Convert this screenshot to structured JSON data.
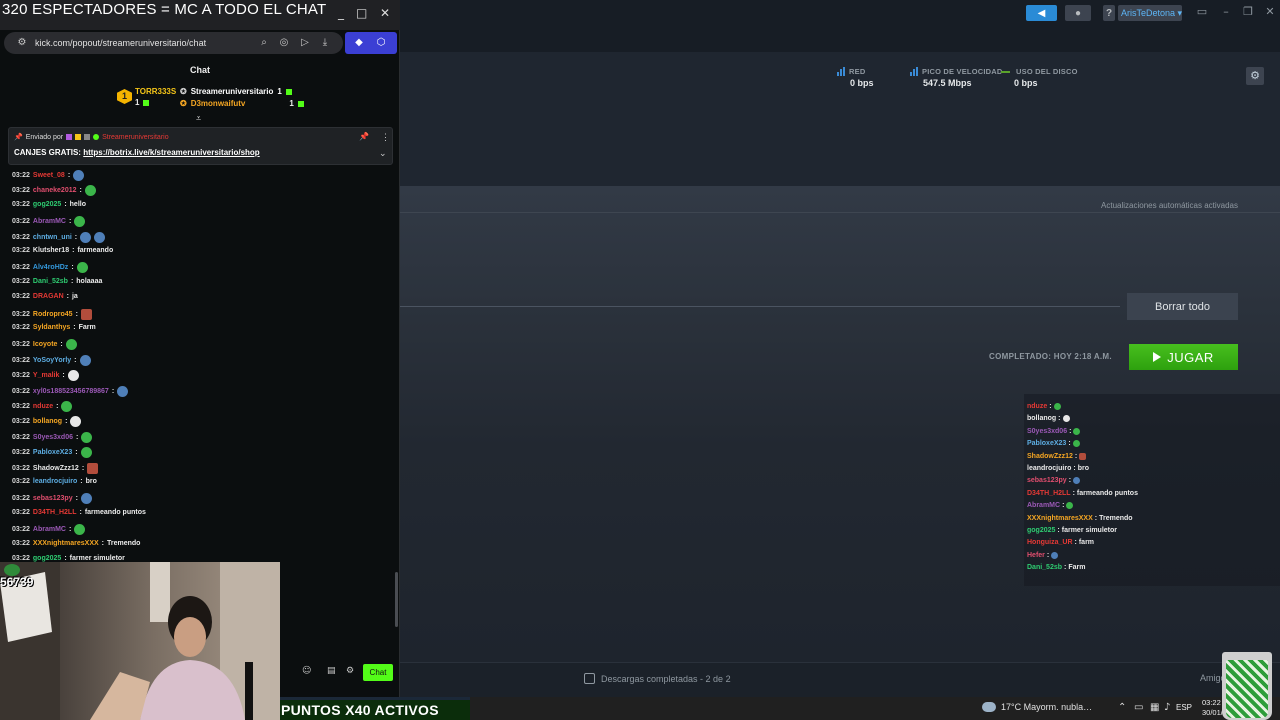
{
  "browser": {
    "window_title": "320 ESPECTADORES = MC A TODO EL CHAT",
    "url": "kick.com/popout/streameruniversitario/chat",
    "controls": {
      "minimize": "_",
      "maximize": "□",
      "close": "✕"
    }
  },
  "chat": {
    "header": "Chat",
    "leaderboard": [
      {
        "rank": "1",
        "name": "TORR333S",
        "count": "1",
        "color": "#f5c518"
      },
      {
        "name": "Streameruniversitario",
        "count": "1",
        "color": "#ffffff"
      },
      {
        "name": "D3monwaifutv",
        "count": "1",
        "color": "#f5a623"
      }
    ],
    "pinned": {
      "by_label": "Enviado por",
      "author": "Streameruniversitario",
      "text": "CANJES GRATIS:",
      "link": "https://botrix.live/k/streameruniversitario/shop"
    },
    "messages": [
      {
        "time": "03:22",
        "user": "Sweet_08",
        "color": "#e53935",
        "text": "",
        "emote": "blue"
      },
      {
        "time": "03:22",
        "user": "chaneke2012",
        "color": "#e04e6e",
        "text": "",
        "emote": "green"
      },
      {
        "time": "03:22",
        "user": "gog2025",
        "color": "#2ecc71",
        "text": "hello",
        "emote": ""
      },
      {
        "time": "03:22",
        "user": "AbramMC",
        "color": "#9b59b6",
        "text": "",
        "emote": "green"
      },
      {
        "time": "03:22",
        "user": "chntwn_uni",
        "color": "#5dade2",
        "text": "",
        "emote": "blue"
      },
      {
        "time": "03:22",
        "user": "Klutsher18",
        "color": "#e8e8e8",
        "text": "farmeando",
        "emote": ""
      },
      {
        "time": "03:22",
        "user": "Alv4roHDz",
        "color": "#3498db",
        "text": "",
        "emote": "green"
      },
      {
        "time": "03:22",
        "user": "Dani_52sb",
        "color": "#2ecc71",
        "text": "holaaaa",
        "emote": ""
      },
      {
        "time": "03:22",
        "user": "DRAGAN",
        "color": "#e53935",
        "text": "ja",
        "emote": ""
      },
      {
        "time": "03:22",
        "user": "Rodropro45",
        "color": "#f5a623",
        "text": "",
        "emote": "red"
      },
      {
        "time": "03:22",
        "user": "Syldanthys",
        "color": "#f5a623",
        "text": "Farm",
        "emote": ""
      },
      {
        "time": "03:22",
        "user": "Icoyote",
        "color": "#f5a623",
        "text": "",
        "emote": "green"
      },
      {
        "time": "03:22",
        "user": "YoSoyYorly",
        "color": "#5dade2",
        "text": "",
        "emote": "blue"
      },
      {
        "time": "03:22",
        "user": "Y_malik",
        "color": "#e53935",
        "text": "",
        "emote": "white"
      },
      {
        "time": "03:22",
        "user": "xyl0s188523456789867",
        "color": "#9b59b6",
        "text": "",
        "emote": "blue"
      },
      {
        "time": "03:22",
        "user": "nduze",
        "color": "#e53935",
        "text": "",
        "emote": "green"
      },
      {
        "time": "03:22",
        "user": "bollanog",
        "color": "#f5a623",
        "text": "",
        "emote": "white"
      },
      {
        "time": "03:22",
        "user": "S0yes3xd06",
        "color": "#9b59b6",
        "text": "",
        "emote": "green"
      },
      {
        "time": "03:22",
        "user": "PabloxeX23",
        "color": "#5dade2",
        "text": "",
        "emote": "green"
      },
      {
        "time": "03:22",
        "user": "ShadowZzz12",
        "color": "#e8e8e8",
        "text": "",
        "emote": "red"
      },
      {
        "time": "03:22",
        "user": "leandrocjuiro",
        "color": "#5dade2",
        "text": "bro",
        "emote": ""
      },
      {
        "time": "03:22",
        "user": "sebas123py",
        "color": "#e04e6e",
        "text": "",
        "emote": "blue"
      },
      {
        "time": "03:22",
        "user": "D34TH_H2LL",
        "color": "#e53935",
        "text": "farmeando puntos",
        "emote": ""
      },
      {
        "time": "03:22",
        "user": "AbramMC",
        "color": "#9b59b6",
        "text": "",
        "emote": "green"
      },
      {
        "time": "03:22",
        "user": "XXXnightmaresXXX",
        "color": "#f5a623",
        "text": "Tremendo",
        "emote": ""
      },
      {
        "time": "03:22",
        "user": "gog2025",
        "color": "#2ecc71",
        "text": "farmer simuletor",
        "emote": ""
      }
    ],
    "send_label": "Chat"
  },
  "webcam": {
    "viewer_count": "56739"
  },
  "banner": {
    "text": "PUNTOS X40 ACTIVOS"
  },
  "steam": {
    "user": "ArisTeDetona",
    "help": "?",
    "stats": [
      {
        "label": "RED",
        "value": "0 bps"
      },
      {
        "label": "PICO DE VELOCIDAD",
        "value": "547.5 Mbps"
      },
      {
        "label": "USO DEL DISCO",
        "value": "0 bps"
      }
    ],
    "auto_updates": "Actualizaciones automáticas activadas",
    "clear_all": "Borrar todo",
    "completed": "COMPLETADO: HOY 2:18 A.M.",
    "play": "JUGAR",
    "downloads_complete": "Descargas completadas - 2 de 2",
    "friends": "Amigo"
  },
  "overlay_chat": [
    {
      "user": "nduze",
      "color": "#e53935",
      "text": "",
      "emote": "green"
    },
    {
      "user": "bollanog",
      "color": "#eaeaea",
      "text": "",
      "emote": "white"
    },
    {
      "user": "S0yes3xd06",
      "color": "#9b59b6",
      "text": "",
      "emote": "green"
    },
    {
      "user": "PabloxeX23",
      "color": "#5dade2",
      "text": "",
      "emote": "green"
    },
    {
      "user": "ShadowZzz12",
      "color": "#f5a623",
      "text": "",
      "emote": "red"
    },
    {
      "user": "leandrocjuiro",
      "color": "#eaeaea",
      "text": "bro",
      "emote": ""
    },
    {
      "user": "sebas123py",
      "color": "#e04e6e",
      "text": "",
      "emote": "blue"
    },
    {
      "user": "D34TH_H2LL",
      "color": "#e53935",
      "text": "farmeando puntos",
      "emote": ""
    },
    {
      "user": "AbramMC",
      "color": "#9b59b6",
      "text": "",
      "emote": "green"
    },
    {
      "user": "XXXnightmaresXXX",
      "color": "#f5a623",
      "text": "Tremendo",
      "emote": ""
    },
    {
      "user": "gog2025",
      "color": "#2ecc71",
      "text": "farmer simuletor",
      "emote": ""
    },
    {
      "user": "Honguiza_UR",
      "color": "#e53935",
      "text": "farm",
      "emote": ""
    },
    {
      "user": "Hefer",
      "color": "#e04e6e",
      "text": "",
      "emote": "blue"
    },
    {
      "user": "Dani_52sb",
      "color": "#2ecc71",
      "text": "Farm",
      "emote": ""
    }
  ],
  "taskbar": {
    "weather": "17°C  Mayorm. nubla…",
    "lang": "ESP",
    "time": "03:22",
    "date": "30/01/"
  },
  "colors": {
    "kick_green": "#53fc18",
    "steam_play": "#47bf1e",
    "steam_blue": "#2a8bd6"
  }
}
